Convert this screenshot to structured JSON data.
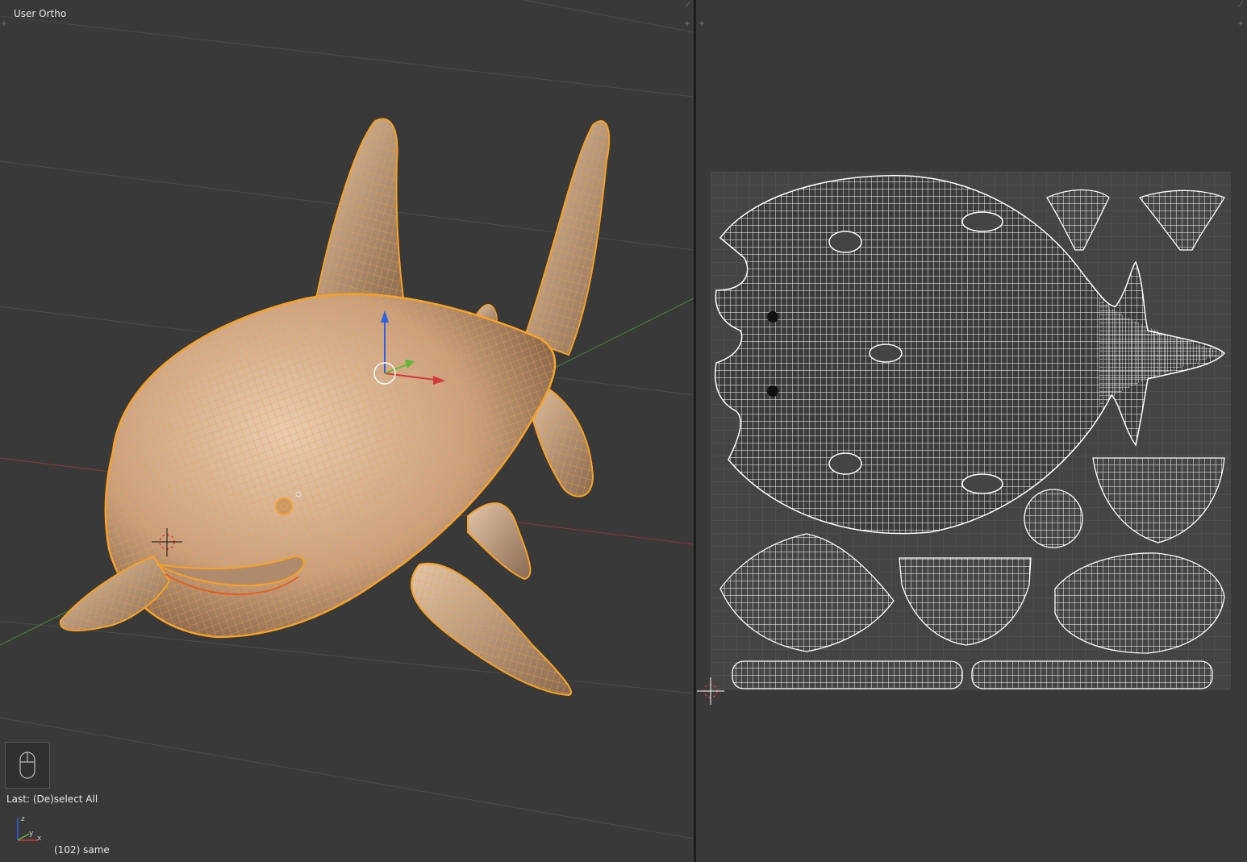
{
  "viewport": {
    "view_label": "User Ortho",
    "last_operator": "Last: (De)select All",
    "object_info": "(102) same",
    "mini_axes": {
      "x": "x",
      "y": "y",
      "z": "z"
    }
  },
  "icons": {
    "mouse": "mouse-icon",
    "gizmo": "transform-gizmo-icon",
    "cursor": "3d-cursor-icon",
    "uv_cursor": "2d-cursor-icon"
  },
  "colors": {
    "background": "#393939",
    "selection": "#f5a22a",
    "axis_x": "#d43a3a",
    "axis_y": "#5fb83a",
    "axis_z": "#3060e0",
    "uv_grid": "#555555",
    "uv_edges": "#ffffff"
  }
}
